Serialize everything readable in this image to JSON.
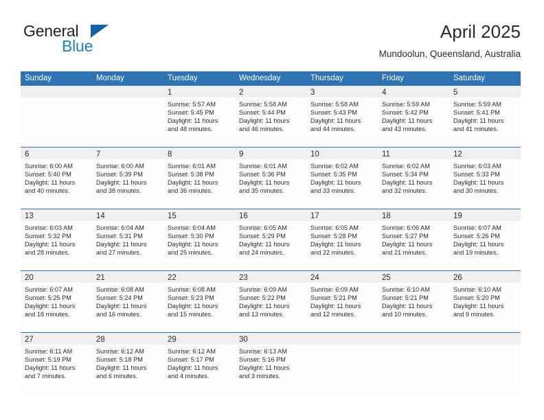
{
  "brand": {
    "name_part1": "General",
    "name_part2": "Blue",
    "accent_color": "#1b7fc4",
    "triangle_color": "#1561a8"
  },
  "header": {
    "title": "April 2025",
    "location": "Mundoolun, Queensland, Australia"
  },
  "theme": {
    "header_blue": "#2e74b5",
    "date_band_gray": "#f0f0f0",
    "cell_white": "#fdfdfd",
    "text_color": "#2b2b2b"
  },
  "weekday_headers": [
    "Sunday",
    "Monday",
    "Tuesday",
    "Wednesday",
    "Thursday",
    "Friday",
    "Saturday"
  ],
  "weeks": [
    [
      {
        "day": "",
        "sunrise": "",
        "sunset": "",
        "daylight_line1": "",
        "daylight_line2": ""
      },
      {
        "day": "",
        "sunrise": "",
        "sunset": "",
        "daylight_line1": "",
        "daylight_line2": ""
      },
      {
        "day": "1",
        "sunrise": "Sunrise: 5:57 AM",
        "sunset": "Sunset: 5:45 PM",
        "daylight_line1": "Daylight: 11 hours",
        "daylight_line2": "and 48 minutes."
      },
      {
        "day": "2",
        "sunrise": "Sunrise: 5:58 AM",
        "sunset": "Sunset: 5:44 PM",
        "daylight_line1": "Daylight: 11 hours",
        "daylight_line2": "and 46 minutes."
      },
      {
        "day": "3",
        "sunrise": "Sunrise: 5:58 AM",
        "sunset": "Sunset: 5:43 PM",
        "daylight_line1": "Daylight: 11 hours",
        "daylight_line2": "and 44 minutes."
      },
      {
        "day": "4",
        "sunrise": "Sunrise: 5:59 AM",
        "sunset": "Sunset: 5:42 PM",
        "daylight_line1": "Daylight: 11 hours",
        "daylight_line2": "and 43 minutes."
      },
      {
        "day": "5",
        "sunrise": "Sunrise: 5:59 AM",
        "sunset": "Sunset: 5:41 PM",
        "daylight_line1": "Daylight: 11 hours",
        "daylight_line2": "and 41 minutes."
      }
    ],
    [
      {
        "day": "6",
        "sunrise": "Sunrise: 6:00 AM",
        "sunset": "Sunset: 5:40 PM",
        "daylight_line1": "Daylight: 11 hours",
        "daylight_line2": "and 40 minutes."
      },
      {
        "day": "7",
        "sunrise": "Sunrise: 6:00 AM",
        "sunset": "Sunset: 5:39 PM",
        "daylight_line1": "Daylight: 11 hours",
        "daylight_line2": "and 38 minutes."
      },
      {
        "day": "8",
        "sunrise": "Sunrise: 6:01 AM",
        "sunset": "Sunset: 5:38 PM",
        "daylight_line1": "Daylight: 11 hours",
        "daylight_line2": "and 36 minutes."
      },
      {
        "day": "9",
        "sunrise": "Sunrise: 6:01 AM",
        "sunset": "Sunset: 5:36 PM",
        "daylight_line1": "Daylight: 11 hours",
        "daylight_line2": "and 35 minutes."
      },
      {
        "day": "10",
        "sunrise": "Sunrise: 6:02 AM",
        "sunset": "Sunset: 5:35 PM",
        "daylight_line1": "Daylight: 11 hours",
        "daylight_line2": "and 33 minutes."
      },
      {
        "day": "11",
        "sunrise": "Sunrise: 6:02 AM",
        "sunset": "Sunset: 5:34 PM",
        "daylight_line1": "Daylight: 11 hours",
        "daylight_line2": "and 32 minutes."
      },
      {
        "day": "12",
        "sunrise": "Sunrise: 6:03 AM",
        "sunset": "Sunset: 5:33 PM",
        "daylight_line1": "Daylight: 11 hours",
        "daylight_line2": "and 30 minutes."
      }
    ],
    [
      {
        "day": "13",
        "sunrise": "Sunrise: 6:03 AM",
        "sunset": "Sunset: 5:32 PM",
        "daylight_line1": "Daylight: 11 hours",
        "daylight_line2": "and 28 minutes."
      },
      {
        "day": "14",
        "sunrise": "Sunrise: 6:04 AM",
        "sunset": "Sunset: 5:31 PM",
        "daylight_line1": "Daylight: 11 hours",
        "daylight_line2": "and 27 minutes."
      },
      {
        "day": "15",
        "sunrise": "Sunrise: 6:04 AM",
        "sunset": "Sunset: 5:30 PM",
        "daylight_line1": "Daylight: 11 hours",
        "daylight_line2": "and 25 minutes."
      },
      {
        "day": "16",
        "sunrise": "Sunrise: 6:05 AM",
        "sunset": "Sunset: 5:29 PM",
        "daylight_line1": "Daylight: 11 hours",
        "daylight_line2": "and 24 minutes."
      },
      {
        "day": "17",
        "sunrise": "Sunrise: 6:05 AM",
        "sunset": "Sunset: 5:28 PM",
        "daylight_line1": "Daylight: 11 hours",
        "daylight_line2": "and 22 minutes."
      },
      {
        "day": "18",
        "sunrise": "Sunrise: 6:06 AM",
        "sunset": "Sunset: 5:27 PM",
        "daylight_line1": "Daylight: 11 hours",
        "daylight_line2": "and 21 minutes."
      },
      {
        "day": "19",
        "sunrise": "Sunrise: 6:07 AM",
        "sunset": "Sunset: 5:26 PM",
        "daylight_line1": "Daylight: 11 hours",
        "daylight_line2": "and 19 minutes."
      }
    ],
    [
      {
        "day": "20",
        "sunrise": "Sunrise: 6:07 AM",
        "sunset": "Sunset: 5:25 PM",
        "daylight_line1": "Daylight: 11 hours",
        "daylight_line2": "and 18 minutes."
      },
      {
        "day": "21",
        "sunrise": "Sunrise: 6:08 AM",
        "sunset": "Sunset: 5:24 PM",
        "daylight_line1": "Daylight: 11 hours",
        "daylight_line2": "and 16 minutes."
      },
      {
        "day": "22",
        "sunrise": "Sunrise: 6:08 AM",
        "sunset": "Sunset: 5:23 PM",
        "daylight_line1": "Daylight: 11 hours",
        "daylight_line2": "and 15 minutes."
      },
      {
        "day": "23",
        "sunrise": "Sunrise: 6:09 AM",
        "sunset": "Sunset: 5:22 PM",
        "daylight_line1": "Daylight: 11 hours",
        "daylight_line2": "and 13 minutes."
      },
      {
        "day": "24",
        "sunrise": "Sunrise: 6:09 AM",
        "sunset": "Sunset: 5:21 PM",
        "daylight_line1": "Daylight: 11 hours",
        "daylight_line2": "and 12 minutes."
      },
      {
        "day": "25",
        "sunrise": "Sunrise: 6:10 AM",
        "sunset": "Sunset: 5:21 PM",
        "daylight_line1": "Daylight: 11 hours",
        "daylight_line2": "and 10 minutes."
      },
      {
        "day": "26",
        "sunrise": "Sunrise: 6:10 AM",
        "sunset": "Sunset: 5:20 PM",
        "daylight_line1": "Daylight: 11 hours",
        "daylight_line2": "and 9 minutes."
      }
    ],
    [
      {
        "day": "27",
        "sunrise": "Sunrise: 6:11 AM",
        "sunset": "Sunset: 5:19 PM",
        "daylight_line1": "Daylight: 11 hours",
        "daylight_line2": "and 7 minutes."
      },
      {
        "day": "28",
        "sunrise": "Sunrise: 6:12 AM",
        "sunset": "Sunset: 5:18 PM",
        "daylight_line1": "Daylight: 11 hours",
        "daylight_line2": "and 6 minutes."
      },
      {
        "day": "29",
        "sunrise": "Sunrise: 6:12 AM",
        "sunset": "Sunset: 5:17 PM",
        "daylight_line1": "Daylight: 11 hours",
        "daylight_line2": "and 4 minutes."
      },
      {
        "day": "30",
        "sunrise": "Sunrise: 6:13 AM",
        "sunset": "Sunset: 5:16 PM",
        "daylight_line1": "Daylight: 11 hours",
        "daylight_line2": "and 3 minutes."
      },
      {
        "day": "",
        "sunrise": "",
        "sunset": "",
        "daylight_line1": "",
        "daylight_line2": ""
      },
      {
        "day": "",
        "sunrise": "",
        "sunset": "",
        "daylight_line1": "",
        "daylight_line2": ""
      },
      {
        "day": "",
        "sunrise": "",
        "sunset": "",
        "daylight_line1": "",
        "daylight_line2": ""
      }
    ]
  ]
}
